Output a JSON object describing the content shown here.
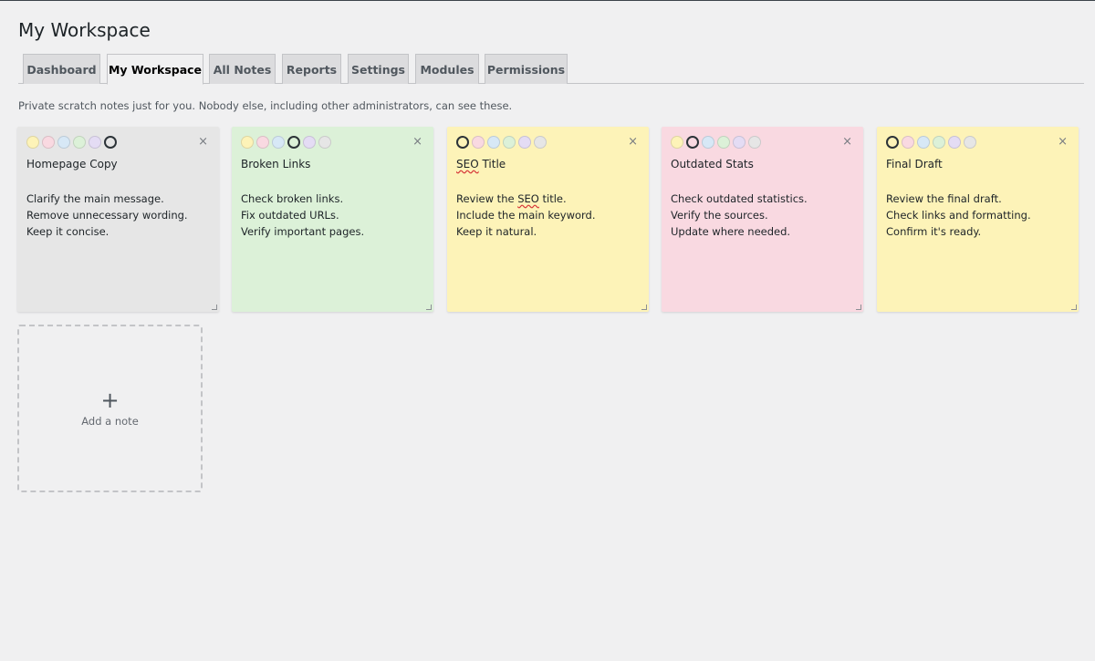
{
  "page": {
    "title": "My Workspace"
  },
  "tabs": [
    {
      "label": "Dashboard",
      "active": false
    },
    {
      "label": "My Workspace",
      "active": true
    },
    {
      "label": "All Notes",
      "active": false
    },
    {
      "label": "Reports",
      "active": false
    },
    {
      "label": "Settings",
      "active": false
    },
    {
      "label": "Modules",
      "active": false
    },
    {
      "label": "Permissions",
      "active": false
    }
  ],
  "intro": "Private scratch notes just for you. Nobody else, including other administrators, can see these.",
  "palette": [
    "#fdf3b8",
    "#f9d9e1",
    "#d7e8f6",
    "#dcf1d8",
    "#e4dcf4",
    "#e6e6e6"
  ],
  "palette_names": [
    "yellow",
    "pink",
    "blue",
    "green",
    "purple",
    "gray"
  ],
  "notes": [
    {
      "title": "Homepage Copy",
      "color": "gray",
      "lines": [
        "Clarify the main message.",
        "Remove unnecessary wording.",
        "Keep it concise."
      ]
    },
    {
      "title": "Broken Links",
      "color": "green",
      "lines": [
        "Check broken links.",
        "Fix outdated URLs.",
        "Verify important pages."
      ]
    },
    {
      "title": "SEO Title",
      "color": "yellow",
      "lines": [
        "Review the SEO title.",
        "Include the main keyword.",
        "Keep it natural."
      ]
    },
    {
      "title": "Outdated Stats",
      "color": "pink",
      "lines": [
        "Check outdated statistics.",
        "Verify the sources.",
        "Update where needed."
      ]
    },
    {
      "title": "Final Draft",
      "color": "yellow",
      "lines": [
        "Review the final draft.",
        "Check links and formatting.",
        "Confirm it's ready."
      ]
    }
  ],
  "close_glyph": "×",
  "add_note": {
    "plus": "+",
    "label": "Add a note"
  }
}
